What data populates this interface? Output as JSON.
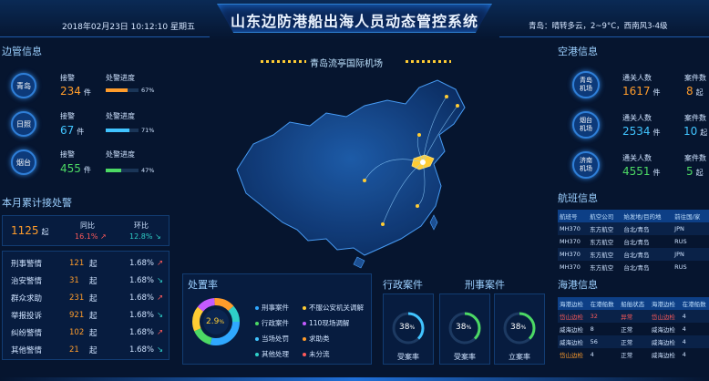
{
  "header": {
    "title": "山东边防港船出海人员动态管控系统",
    "datetime": "2018年02月23日  10:12:10  星期五",
    "weather": "青岛：晴转多云，2~9°C，西南风3-4级"
  },
  "border": {
    "title": "边管信息",
    "items": [
      {
        "name": "青岛",
        "alert_label": "接警",
        "value": "234",
        "unit": "件",
        "progress_label": "处警进度",
        "progress": 67,
        "progress_text": "67%",
        "color": "#ff9c2b"
      },
      {
        "name": "日照",
        "alert_label": "接警",
        "value": "67",
        "unit": "件",
        "progress_label": "处警进度",
        "progress": 71,
        "progress_text": "71%",
        "color": "#41c4ff"
      },
      {
        "name": "烟台",
        "alert_label": "接警",
        "value": "455",
        "unit": "件",
        "progress_label": "处警进度",
        "progress": 47,
        "progress_text": "47%",
        "color": "#4cd964"
      }
    ]
  },
  "monthly": {
    "title": "本月累计接处警",
    "total": "1125",
    "total_unit": "起",
    "yoy_label": "同比",
    "yoy": "16.1%",
    "mom_label": "环比",
    "mom": "12.8%",
    "rows": [
      {
        "name": "刑事警情",
        "value": "121",
        "unit": "起",
        "pct": "1.68%",
        "dir": "up"
      },
      {
        "name": "治安警情",
        "value": "31",
        "unit": "起",
        "pct": "1.68%",
        "dir": "down"
      },
      {
        "name": "群众求助",
        "value": "231",
        "unit": "起",
        "pct": "1.68%",
        "dir": "up"
      },
      {
        "name": "举报投诉",
        "value": "921",
        "unit": "起",
        "pct": "1.68%",
        "dir": "down"
      },
      {
        "name": "纠纷警情",
        "value": "102",
        "unit": "起",
        "pct": "1.68%",
        "dir": "up"
      },
      {
        "name": "其他警情",
        "value": "21",
        "unit": "起",
        "pct": "1.68%",
        "dir": "down"
      }
    ]
  },
  "map": {
    "title": "青岛流亭国际机场"
  },
  "disposal": {
    "title": "处置率",
    "center": "2.9",
    "center_unit": "%",
    "legend": [
      {
        "label": "刑事案件",
        "color": "#2fa8ff"
      },
      {
        "label": "不服公安机关调解",
        "color": "#ffcc33"
      },
      {
        "label": "行政案件",
        "color": "#4cd964"
      },
      {
        "label": "110现场调解",
        "color": "#c45bff"
      },
      {
        "label": "当场处罚",
        "color": "#41c4ff"
      },
      {
        "label": "求助类",
        "color": "#ff9c2b"
      },
      {
        "label": "其他处理",
        "color": "#2fd0c8"
      },
      {
        "label": "未分流",
        "color": "#ff5a5a"
      }
    ]
  },
  "admin_cases": {
    "title": "行政案件",
    "gauges": [
      {
        "value": "38",
        "unit": "%",
        "label": "受案率",
        "color": "#41c4ff"
      }
    ]
  },
  "criminal_cases": {
    "title": "刑事案件",
    "gauges": [
      {
        "value": "38",
        "unit": "%",
        "label": "受案率",
        "color": "#4cd964"
      },
      {
        "value": "38",
        "unit": "%",
        "label": "立案率",
        "color": "#4cd964"
      }
    ]
  },
  "airport": {
    "title": "空港信息",
    "items": [
      {
        "name": "青岛机场",
        "people_label": "通关人数",
        "people": "1617",
        "people_unit": "件",
        "case_label": "案件数",
        "cases": "8",
        "case_unit": "起",
        "color": "#ff9c2b"
      },
      {
        "name": "烟台机场",
        "people_label": "通关人数",
        "people": "2534",
        "people_unit": "件",
        "case_label": "案件数",
        "cases": "10",
        "case_unit": "起",
        "color": "#41c4ff"
      },
      {
        "name": "济南机场",
        "people_label": "通关人数",
        "people": "4551",
        "people_unit": "件",
        "case_label": "案件数",
        "cases": "5",
        "case_unit": "起",
        "color": "#4cd964"
      }
    ]
  },
  "flights": {
    "title": "航班信息",
    "headers": [
      "航班号",
      "航空公司",
      "始发地/目的地",
      "前往国/家"
    ],
    "rows": [
      [
        "MH370",
        "东方航空",
        "台北/青岛",
        "JPN"
      ],
      [
        "MH370",
        "东方航空",
        "台北/青岛",
        "RUS"
      ],
      [
        "MH370",
        "东方航空",
        "台北/青岛",
        "JPN"
      ],
      [
        "MH370",
        "东方航空",
        "台北/青岛",
        "RUS"
      ]
    ]
  },
  "seaport": {
    "title": "海港信息",
    "headers": [
      "海港边检",
      "在港船数",
      "船舶状态",
      "海港边检",
      "在港船数",
      "船"
    ],
    "rows": [
      [
        "岱山边检",
        "32",
        "异常",
        "岱山边检",
        "4",
        "正"
      ],
      [
        "威海边检",
        "8",
        "正常",
        "威海边检",
        "4",
        "正"
      ],
      [
        "威海边检",
        "56",
        "正常",
        "威海边检",
        "4",
        "正"
      ],
      [
        "岱山边检",
        "4",
        "正常",
        "威海边检",
        "4",
        "正"
      ]
    ]
  }
}
